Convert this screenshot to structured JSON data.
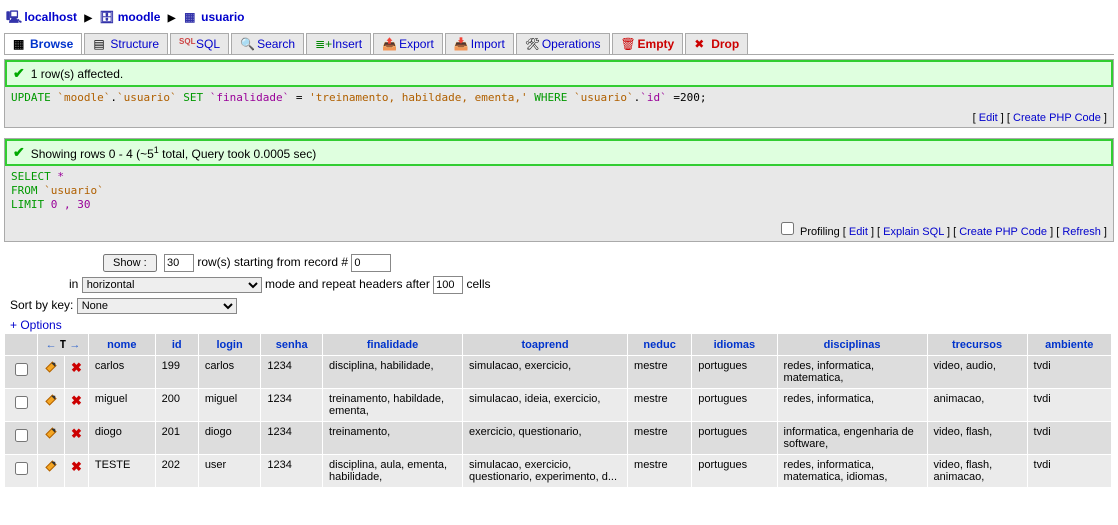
{
  "breadcrumb": {
    "server": "localhost",
    "db": "moodle",
    "table": "usuario"
  },
  "tabs": [
    {
      "key": "browse",
      "label": "Browse",
      "active": true,
      "color": "#0033cc"
    },
    {
      "key": "structure",
      "label": "Structure"
    },
    {
      "key": "sql",
      "label": "SQL"
    },
    {
      "key": "search",
      "label": "Search"
    },
    {
      "key": "insert",
      "label": "Insert"
    },
    {
      "key": "export",
      "label": "Export"
    },
    {
      "key": "import",
      "label": "Import"
    },
    {
      "key": "operations",
      "label": "Operations"
    },
    {
      "key": "empty",
      "label": "Empty",
      "color": "#c00"
    },
    {
      "key": "drop",
      "label": "Drop",
      "color": "#c00"
    }
  ],
  "msg1": {
    "text": "1 row(s) affected.",
    "sql": "UPDATE `moodle`.`usuario` SET `finalidade` = 'treinamento, habildade, ementa,' WHERE `usuario`.`id` =200;",
    "edit": "Edit",
    "create": "Create PHP Code"
  },
  "msg2": {
    "text_pre": "Showing rows 0 - 4 (~5",
    "text_sup": "1",
    "text_post": " total, Query took 0.0005 sec)",
    "sql_l1_a": "SELECT",
    "sql_l1_b": " *",
    "sql_l2_a": "FROM",
    "sql_l2_b": " `usuario`",
    "sql_l3_a": "LIMIT",
    "sql_l3_b": " 0 , 30",
    "profiling": "Profiling",
    "edit": "Edit",
    "explain": "Explain SQL",
    "create": "Create PHP Code",
    "refresh": "Refresh"
  },
  "controls": {
    "show_btn": "Show :",
    "rows": "30",
    "rows_label": "row(s) starting from record #",
    "start": "0",
    "in": "in",
    "mode": "horizontal",
    "mode_label": "mode and repeat headers after",
    "repeat": "100",
    "cells": "cells",
    "sort_label": "Sort by key:",
    "sort_val": "None",
    "options": "+ Options"
  },
  "headers": [
    "nome",
    "id",
    "login",
    "senha",
    "finalidade",
    "toaprend",
    "neduc",
    "idiomas",
    "disciplinas",
    "trecursos",
    "ambiente"
  ],
  "rows": [
    {
      "nome": "carlos",
      "id": "199",
      "login": "carlos",
      "senha": "1234",
      "finalidade": "disciplina, habilidade,",
      "toaprend": "simulacao, exercicio,",
      "neduc": "mestre",
      "idiomas": "portugues",
      "disciplinas": "redes, informatica, matematica,",
      "trecursos": "video, audio,",
      "ambiente": "tvdi"
    },
    {
      "nome": "miguel",
      "id": "200",
      "login": "miguel",
      "senha": "1234",
      "finalidade": "treinamento, habildade, ementa,",
      "toaprend": "simulacao, ideia, exercicio,",
      "neduc": "mestre",
      "idiomas": "portugues",
      "disciplinas": "redes, informatica,",
      "trecursos": "animacao,",
      "ambiente": "tvdi"
    },
    {
      "nome": "diogo",
      "id": "201",
      "login": "diogo",
      "senha": "1234",
      "finalidade": "treinamento,",
      "toaprend": "exercicio, questionario,",
      "neduc": "mestre",
      "idiomas": "portugues",
      "disciplinas": "informatica, engenharia de software,",
      "trecursos": "video, flash,",
      "ambiente": "tvdi"
    },
    {
      "nome": "TESTE",
      "id": "202",
      "login": "user",
      "senha": "1234",
      "finalidade": "disciplina, aula, ementa, habilidade,",
      "toaprend": "simulacao, exercicio, questionario, experimento, d...",
      "neduc": "mestre",
      "idiomas": "portugues",
      "disciplinas": "redes, informatica, matematica, idiomas,",
      "trecursos": "video, flash, animacao,",
      "ambiente": "tvdi"
    }
  ]
}
